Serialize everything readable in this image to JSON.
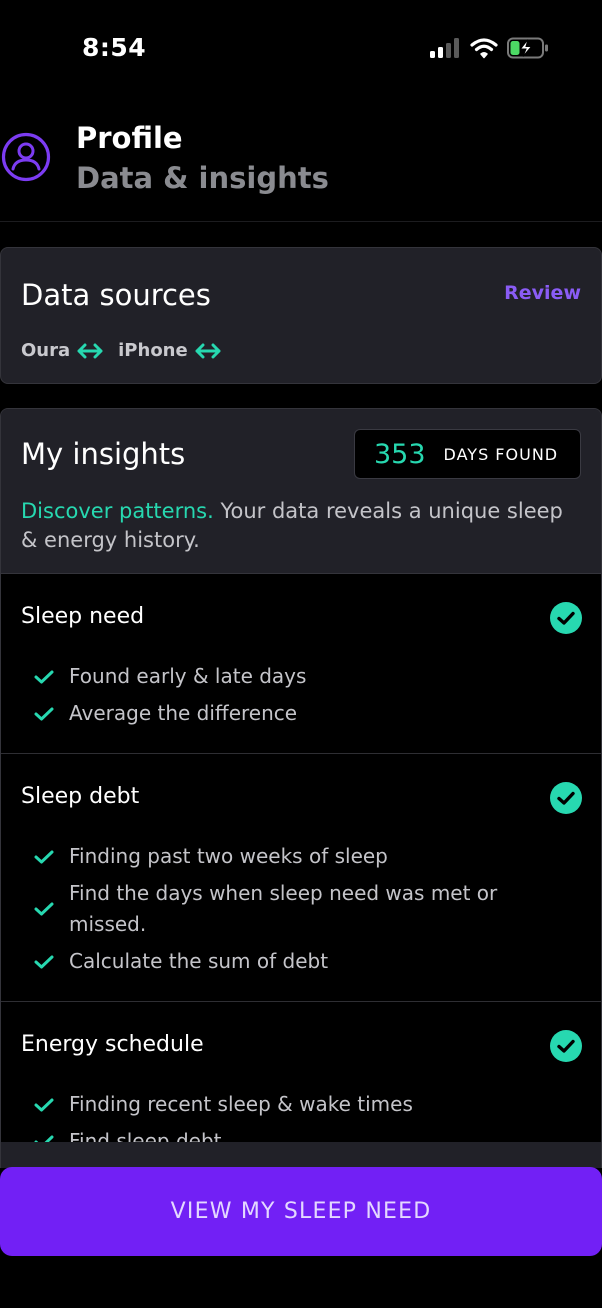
{
  "status_bar": {
    "time": "8:54"
  },
  "header": {
    "title": "Profile",
    "subtitle": "Data & insights"
  },
  "data_sources": {
    "title": "Data sources",
    "review_label": "Review",
    "sources": [
      "Oura",
      "iPhone"
    ]
  },
  "insights": {
    "title": "My insights",
    "days_count": "353",
    "days_label": "DAYS FOUND",
    "desc_accent": "Discover patterns.",
    "desc_rest": " Your data reveals a unique sleep & energy history.",
    "sections": [
      {
        "title": "Sleep need",
        "items": [
          "Found early & late days",
          "Average the difference"
        ]
      },
      {
        "title": "Sleep debt",
        "items": [
          "Finding past two weeks of sleep",
          "Find the days when sleep need was met or missed.",
          "Calculate the sum of debt"
        ]
      },
      {
        "title": "Energy schedule",
        "items": [
          "Finding recent sleep & wake times",
          "Find sleep debt"
        ]
      }
    ]
  },
  "cta": {
    "label": "VIEW MY SLEEP NEED"
  },
  "colors": {
    "accent_teal": "#27d8b0",
    "accent_purple": "#8a5cf5",
    "button_purple": "#7220f5"
  },
  "icons": [
    "signal-icon",
    "wifi-icon",
    "battery-charging-icon",
    "profile-icon",
    "sync-arrows-icon",
    "check-circle-icon",
    "checkmark-icon"
  ]
}
